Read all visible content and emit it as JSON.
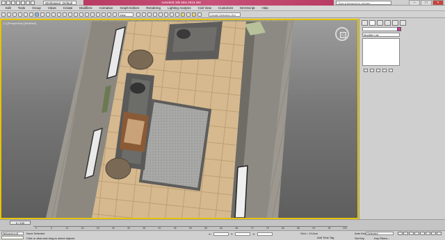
{
  "title_bar": {
    "workspace_dropdown": "Workspace: Default",
    "app_title": "Autodesk 3ds Max 2013 x64",
    "search_placeholder": "Type a keyword or phrase"
  },
  "menu": [
    "Edit",
    "Tools",
    "Group",
    "Views",
    "Create",
    "Modifiers",
    "Animation",
    "Graph Editors",
    "Rendering",
    "Lighting Analysis",
    "Civil View",
    "Customize",
    "MAXScript",
    "Help"
  ],
  "toolbar": {
    "view_dropdown": "View",
    "selection_set_placeholder": "Create Selection Set"
  },
  "viewport": {
    "label": "[+] [Perspective] [Realistic]"
  },
  "command_panel": {
    "modifier_list": "Modifier List"
  },
  "timeline": {
    "frame_counter": "0 / 100",
    "ticks": [
      "0",
      "5",
      "10",
      "15",
      "20",
      "25",
      "30",
      "35",
      "40",
      "45",
      "50",
      "55",
      "60",
      "65",
      "70",
      "75",
      "80",
      "85",
      "90",
      "95",
      "100"
    ]
  },
  "status_bar": {
    "maxscript_text": "Welcome to M",
    "selection_status": "None Selected",
    "prompt": "Click or click-and-drag to select objects",
    "x_label": "X:",
    "y_label": "Y:",
    "z_label": "Z:",
    "grid": "Grid = 10,0cm",
    "add_time_tag": "Add Time Tag",
    "auto_key": "Auto Key",
    "auto_key_value": "Selected",
    "set_key": "Set Key",
    "key_filters": "Key Filters..."
  }
}
